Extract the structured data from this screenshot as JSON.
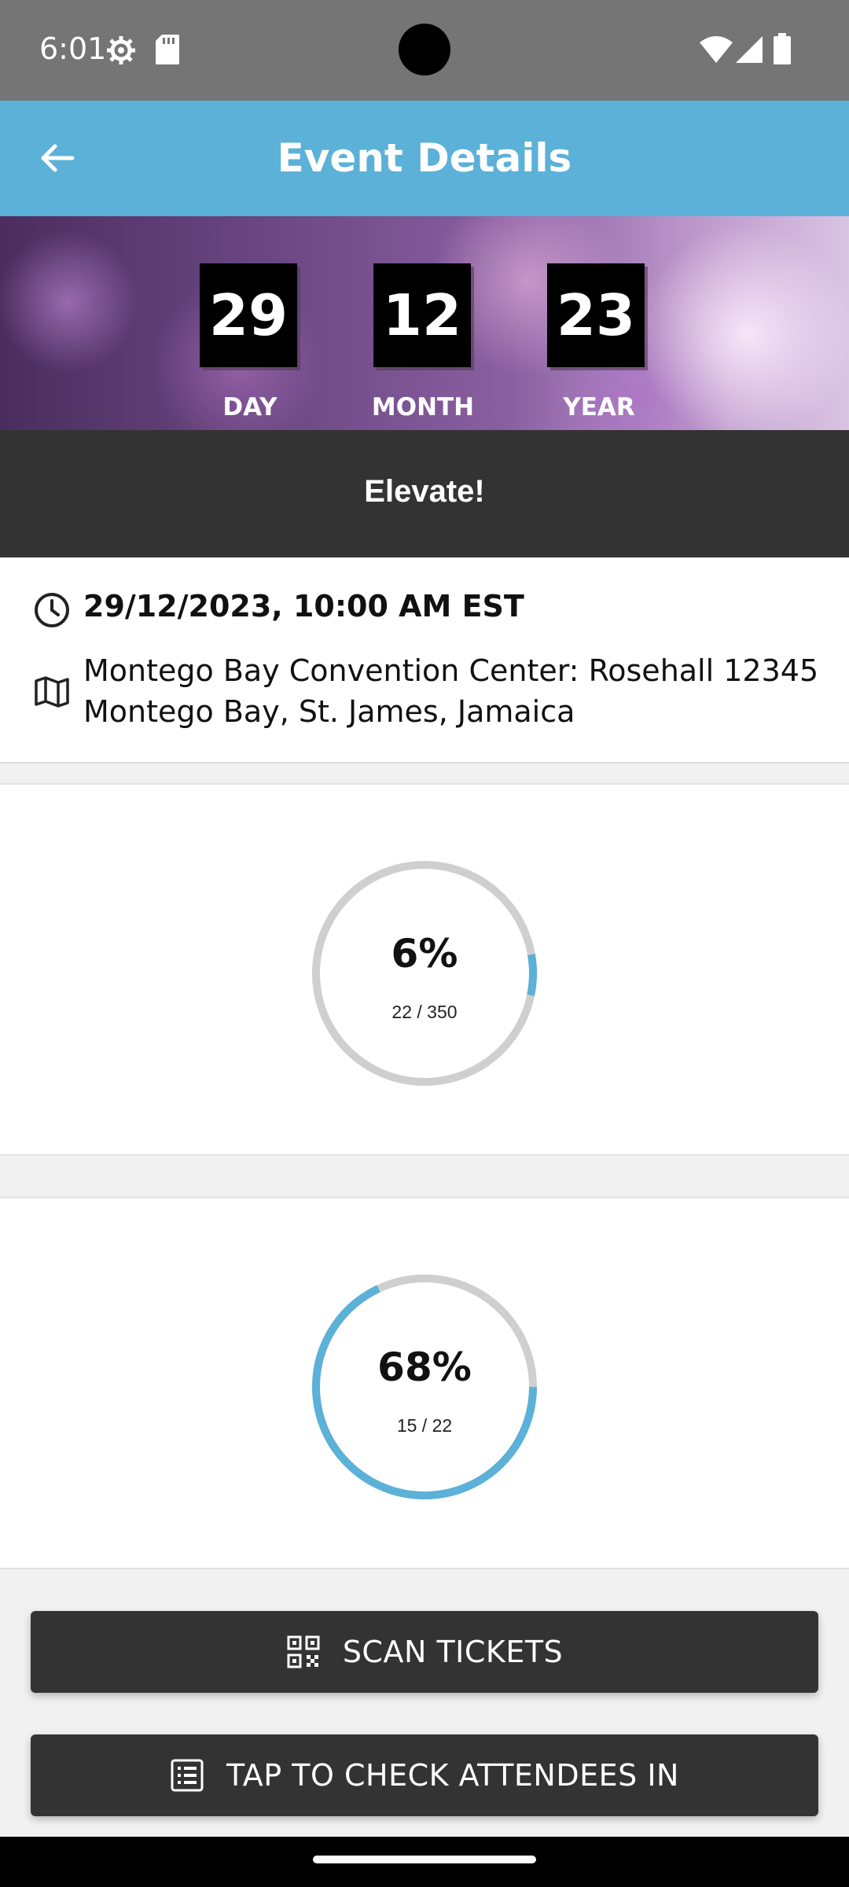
{
  "status_bar": {
    "time": "6:01",
    "icons": [
      "settings-gear-icon",
      "sd-card-icon",
      "wifi-icon",
      "cellular-signal-icon",
      "battery-icon"
    ]
  },
  "app_bar": {
    "title": "Event Details",
    "back_icon": "arrow-left-icon",
    "background_color": "#5bb1d7"
  },
  "countdown": {
    "day": {
      "value": "29",
      "label": "DAY"
    },
    "month": {
      "value": "12",
      "label": "MONTH"
    },
    "year": {
      "value": "23",
      "label": "YEAR"
    }
  },
  "event": {
    "name": "Elevate!",
    "datetime": "29/12/2023, 10:00 AM EST",
    "address": "Montego Bay Convention Center: Rosehall 12345 Montego Bay, St. James, Jamaica",
    "datetime_icon": "clock-icon",
    "address_icon": "map-icon"
  },
  "progress": [
    {
      "percent_label": "6%",
      "count_label": "22 / 350",
      "fraction": 0.06
    },
    {
      "percent_label": "68%",
      "count_label": "15 / 22",
      "fraction": 0.68
    }
  ],
  "ring_colors": {
    "track": "#cfcfcf",
    "fill": "#5bb1d7"
  },
  "actions": {
    "scan_label": "SCAN TICKETS",
    "scan_icon": "qr-code-icon",
    "checkin_label": "TAP TO CHECK ATTENDEES IN",
    "checkin_icon": "list-icon"
  }
}
